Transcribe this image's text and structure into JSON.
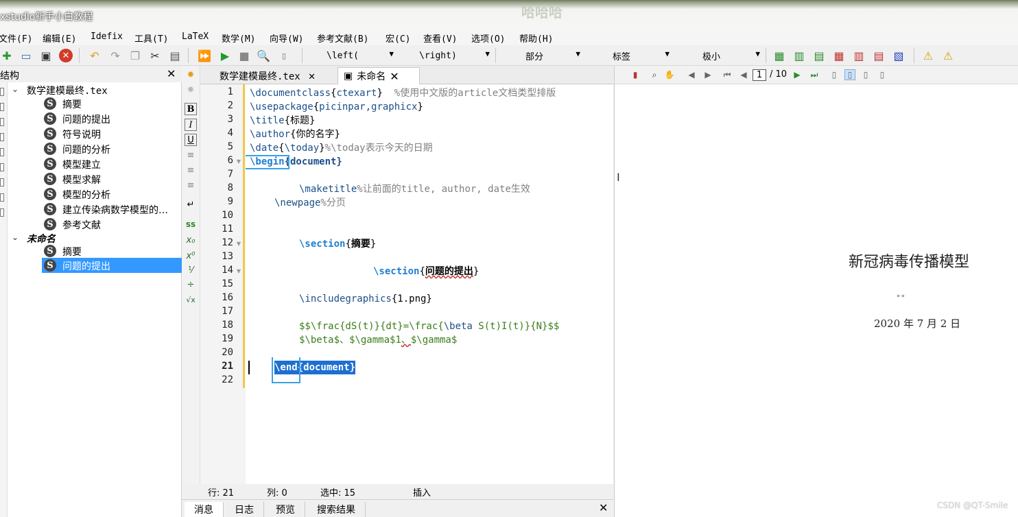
{
  "window": {
    "title": "xstudio新手小白教程",
    "center_overlay": "哈哈哈"
  },
  "menu": [
    "文件(F)",
    "编辑(E)",
    "Idefix",
    "工具(T)",
    "LaTeX",
    "数学(M)",
    "向导(W)",
    "参考文献(B)",
    "宏(C)",
    "查看(V)",
    "选项(O)",
    "帮助(H)"
  ],
  "toolbar": {
    "left_combo": "\\left(",
    "right_combo": "\\right)",
    "section_combo": "部分",
    "label_combo": "标签",
    "size_combo": "极小"
  },
  "structure": {
    "title": "结构",
    "doc1": "数学建模最终.tex",
    "doc1_items": [
      "摘要",
      "问题的提出",
      "符号说明",
      "问题的分析",
      "模型建立",
      "模型求解",
      "模型的分析",
      "建立传染病数学模型的…",
      "参考文献"
    ],
    "doc2": "未命名",
    "doc2_items": [
      "摘要",
      "问题的提出"
    ],
    "section_icon_letter": "S"
  },
  "leftbar": [
    "B",
    "I",
    "U",
    "ss",
    "√x"
  ],
  "tabs": [
    {
      "label": "数学建模最终.tex"
    },
    {
      "label": "未命名"
    }
  ],
  "editor": {
    "line_numbers": [
      "1",
      "2",
      "3",
      "4",
      "5",
      "6",
      "7",
      "8",
      "9",
      "10",
      "11",
      "12",
      "13",
      "14",
      "15",
      "16",
      "17",
      "18",
      "19",
      "20",
      "21",
      "22"
    ],
    "current_line": 21
  },
  "status": {
    "row_label": "行: 21",
    "col_label": "列: 0",
    "sel_label": "选中: 15",
    "mode": "插入"
  },
  "bottom_tabs": [
    "消息",
    "日志",
    "预览",
    "搜索结果"
  ],
  "pdf": {
    "page_current": "1",
    "page_total": "/ 10",
    "title": "新冠病毒传播模型",
    "author_dots": "∘∘",
    "date": "2020 年 7 月 2 日"
  },
  "watermark": "CSDN @QT-Smile",
  "colors": {
    "keyword": "#1b4f8a",
    "comment": "#808080",
    "math": "#3a7d1c",
    "selection": "#3399ff",
    "fold_bar": "#f2c84a"
  }
}
